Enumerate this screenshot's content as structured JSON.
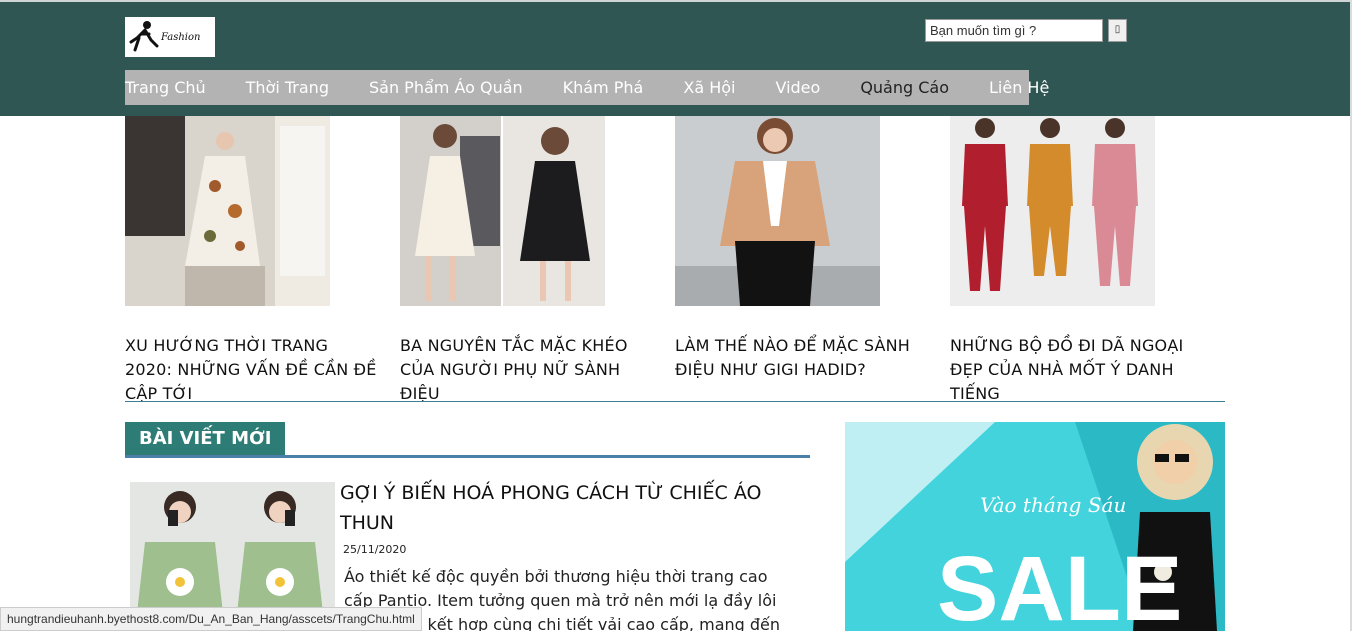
{
  "header": {
    "logo_text": "Fashion",
    "search_placeholder": "Bạn muốn tìm gì ?",
    "search_button_icon": "search-icon"
  },
  "nav": {
    "items": [
      "Trang Chủ",
      "Thời Trang",
      "Sản Phẩm Áo Quần",
      "Khám Phá",
      "Xã Hội",
      "Video",
      "Quảng Cáo",
      "Liên Hệ"
    ]
  },
  "featured": [
    {
      "title": "XU HƯỚNG THỜI TRANG 2020: NHỮNG VẤN ĐỀ CẦN ĐỀ CẬP TỚI"
    },
    {
      "title": "BA NGUYÊN TẮC MẶC KHÉO CỦA NGƯỜI PHỤ NỮ SÀNH ĐIỆU"
    },
    {
      "title": "LÀM THẾ NÀO ĐỂ MẶC SÀNH ĐIỆU NHƯ GIGI HADID?"
    },
    {
      "title": "NHỮNG BỘ ĐỒ ĐI DÃ NGOẠI ĐẸP CỦA NHÀ MỐT Ý DANH TIẾNG"
    }
  ],
  "section": {
    "title": "BÀI VIẾT MỚI"
  },
  "post": {
    "title": "GỢI Ý BIẾN HOÁ PHONG CÁCH TỪ CHIẾC ÁO THUN",
    "date": "25/11/2020",
    "excerpt": "Áo thiết kế độc quyền bởi thương hiệu thời trang cao cấp Pantio. Item tưởng quen mà trở nên mới lạ đầy lôi cuốn, vẫn kết hợp cùng chi tiết vải cao cấp, mang đến"
  },
  "ad": {
    "script_text": "Vào tháng Sáu",
    "headline": "SALE"
  },
  "status_bar": {
    "url": "hungtrandieuhanh.byethost8.com/Du_An_Ban_Hang/asscets/TrangChu.html"
  },
  "colors": {
    "header_bg": "#2f5652",
    "nav_bg": "#b3b3b3",
    "accent": "#2d7d76",
    "ad_bg": "#43d3dc"
  }
}
